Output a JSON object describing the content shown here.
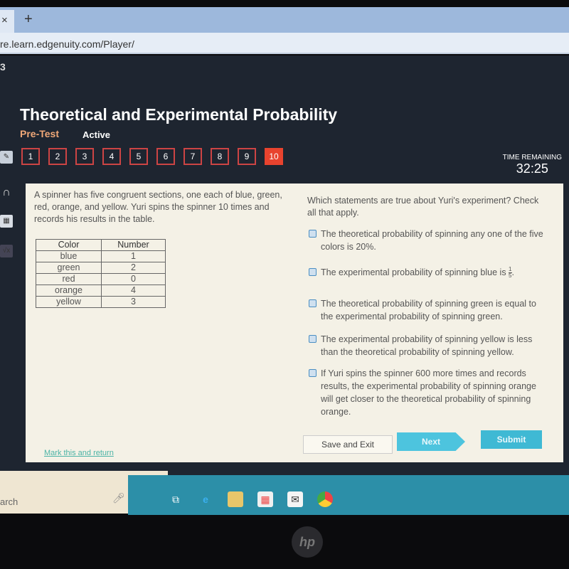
{
  "browser": {
    "close_glyph": "×",
    "new_tab_glyph": "+",
    "url": "re.learn.edgenuity.com/Player/"
  },
  "app": {
    "header_fragment": "3",
    "title": "Theoretical and Experimental Probability",
    "subtitle": "Pre-Test",
    "status": "Active",
    "questions": [
      "1",
      "2",
      "3",
      "4",
      "5",
      "6",
      "7",
      "8",
      "9",
      "10"
    ],
    "current_question": "10",
    "timer": {
      "label": "TIME REMAINING",
      "value": "32:25"
    },
    "side_tools": [
      "pencil-icon",
      "headphones-icon",
      "calculator-icon",
      "sqrt-icon"
    ],
    "sqrt_glyph": "√x"
  },
  "prompt": "A spinner has five congruent sections, one each of blue, green, red, orange, and yellow. Yuri spins the spinner 10 times and records his results in the table.",
  "table": {
    "headers": [
      "Color",
      "Number"
    ],
    "rows": [
      [
        "blue",
        "1"
      ],
      [
        "green",
        "2"
      ],
      [
        "red",
        "0"
      ],
      [
        "orange",
        "4"
      ],
      [
        "yellow",
        "3"
      ]
    ]
  },
  "question": "Which statements are true about Yuri's experiment? Check all that apply.",
  "options": [
    {
      "text": "The theoretical probability of spinning any one of the five colors is 20%.",
      "checked": false
    },
    {
      "text": "The experimental probability of spinning blue is ",
      "fraction": {
        "num": "1",
        "den": "5"
      },
      "suffix": ".",
      "checked": false
    },
    {
      "text": "The theoretical probability of spinning green is equal to the experimental probability of spinning green.",
      "checked": false
    },
    {
      "text": "The experimental probability of spinning yellow is less than the theoretical probability of spinning yellow.",
      "checked": false
    },
    {
      "text": "If Yuri spins the spinner 600 more times and records results, the experimental probability of spinning orange will get closer to the theoretical probability of spinning orange.",
      "checked": false
    }
  ],
  "buttons": {
    "mark": "Mark this and return",
    "save": "Save and Exit",
    "next": "Next",
    "submit": "Submit"
  },
  "colors": {
    "accent": "#e8432e",
    "button": "#4dc4de",
    "subtitle": "#f0a878",
    "header": "#1e2530",
    "taskbar": "#2c8fa8"
  },
  "taskbar": {
    "search_text": "arch",
    "icons": [
      "task-view-icon",
      "edge-icon",
      "file-explorer-icon",
      "store-icon",
      "mail-icon",
      "chrome-icon"
    ]
  },
  "logo": "hp"
}
